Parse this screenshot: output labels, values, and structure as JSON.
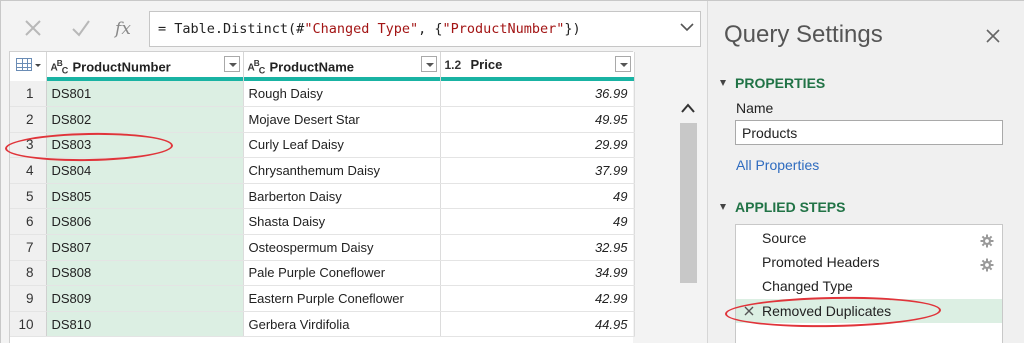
{
  "formula_bar": {
    "formula_prefix": "= Table.Distinct(#",
    "formula_step": "\"Changed Type\"",
    "formula_mid": ", {",
    "formula_arg": "\"ProductNumber\"",
    "formula_end": "})",
    "fx_label": "fx"
  },
  "columns": [
    {
      "type": "ABC",
      "name": "ProductNumber"
    },
    {
      "type": "ABC",
      "name": "ProductName"
    },
    {
      "type": "1.2",
      "name": "Price"
    }
  ],
  "rows": [
    {
      "n": "1",
      "number": "DS801",
      "name": "Rough Daisy",
      "price": "36.99"
    },
    {
      "n": "2",
      "number": "DS802",
      "name": "Mojave Desert Star",
      "price": "49.95"
    },
    {
      "n": "3",
      "number": "DS803",
      "name": "Curly Leaf Daisy",
      "price": "29.99"
    },
    {
      "n": "4",
      "number": "DS804",
      "name": "Chrysanthemum Daisy",
      "price": "37.99"
    },
    {
      "n": "5",
      "number": "DS805",
      "name": "Barberton Daisy",
      "price": "49"
    },
    {
      "n": "6",
      "number": "DS806",
      "name": "Shasta Daisy",
      "price": "49"
    },
    {
      "n": "7",
      "number": "DS807",
      "name": "Osteospermum Daisy",
      "price": "32.95"
    },
    {
      "n": "8",
      "number": "DS808",
      "name": "Pale Purple Coneflower",
      "price": "34.99"
    },
    {
      "n": "9",
      "number": "DS809",
      "name": "Eastern Purple Coneflower",
      "price": "42.99"
    },
    {
      "n": "10",
      "number": "DS810",
      "name": "Gerbera Virdifolia",
      "price": "44.95"
    }
  ],
  "query_settings": {
    "title": "Query Settings",
    "properties_header": "PROPERTIES",
    "name_label": "Name",
    "name_value": "Products",
    "all_properties_link": "All Properties",
    "applied_steps_header": "APPLIED STEPS",
    "steps": [
      {
        "label": "Source",
        "has_gear": true
      },
      {
        "label": "Promoted Headers",
        "has_gear": true
      },
      {
        "label": "Changed Type",
        "has_gear": false
      },
      {
        "label": "Removed Duplicates",
        "has_gear": false,
        "active": true
      }
    ]
  },
  "colors": {
    "accent_teal": "#19b3a3",
    "selected_column_bg": "#dcefe3",
    "section_header_green": "#217346",
    "link_blue": "#2e6bbf",
    "annotation_red": "#e0343a",
    "formula_string_red": "#a31515"
  },
  "icons": {
    "cancel": "close-x-icon",
    "commit": "checkmark-icon",
    "function": "fx-icon",
    "expand": "chevron-down-icon",
    "table_menu": "table-grid-icon",
    "scroll_up": "chevron-up-icon",
    "close_pane": "close-icon",
    "step_settings": "gear-icon",
    "delete_step": "delete-x-icon"
  }
}
